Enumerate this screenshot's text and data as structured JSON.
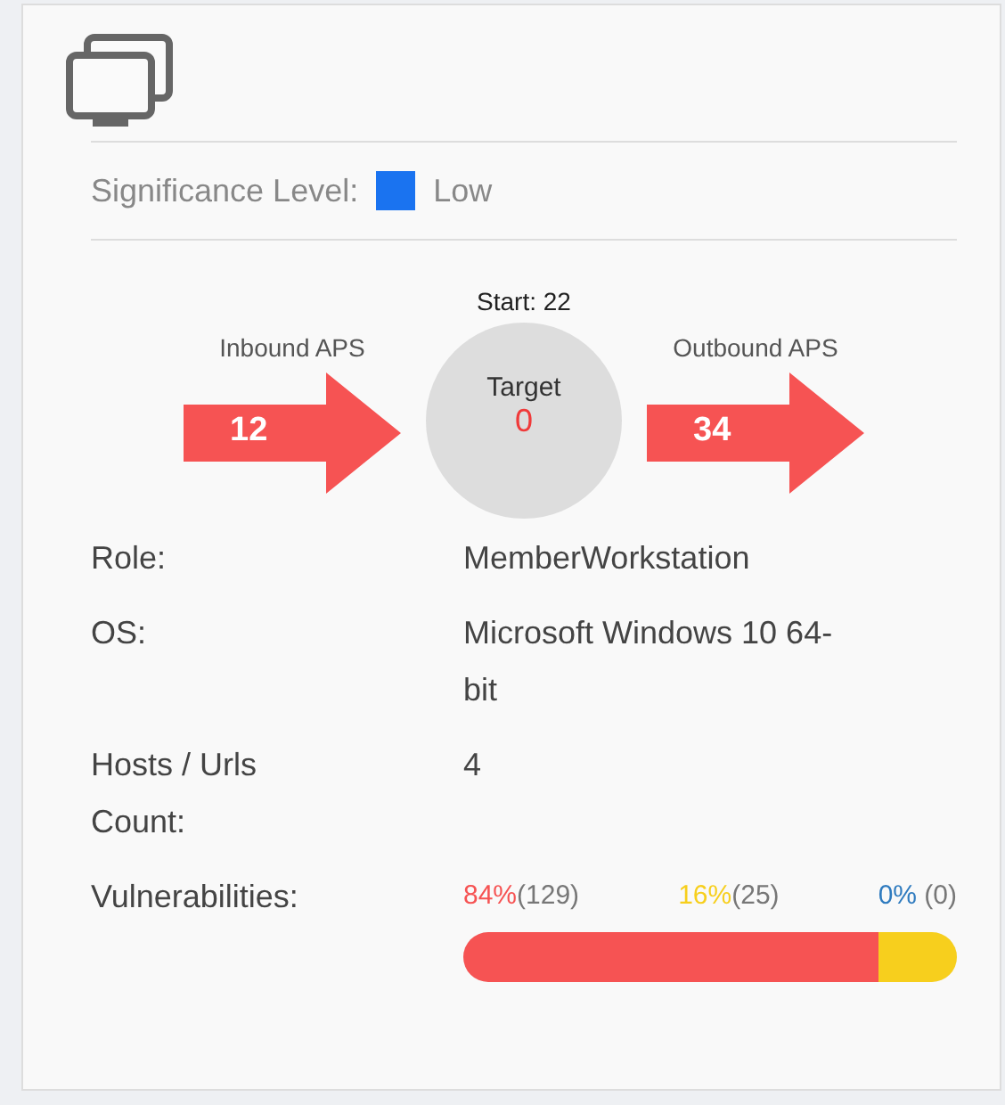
{
  "significance": {
    "label": "Significance Level:",
    "value": "Low",
    "color": "#1a73f0"
  },
  "flow": {
    "start": "Start: 22",
    "inbound": {
      "label": "Inbound APS",
      "count": "12"
    },
    "target": {
      "label": "Target",
      "count": "0"
    },
    "outbound": {
      "label": "Outbound APS",
      "count": "34"
    }
  },
  "details": [
    {
      "label": "Role:",
      "value": "MemberWorkstation"
    },
    {
      "label": "OS:",
      "value": "Microsoft Windows 10 64-bit"
    },
    {
      "label": "Hosts / Urls Count:",
      "value": "4"
    }
  ],
  "vulnerabilities": {
    "label": "Vulnerabilities:",
    "stats": [
      {
        "percent": "84%",
        "count": "(129)",
        "color": "#f65353"
      },
      {
        "percent": "16%",
        "count": "(25)",
        "color": "#f7cf1d"
      },
      {
        "percent": "0%",
        "count": " (0)",
        "color": "#2f7bbf"
      }
    ],
    "bar": [
      {
        "color": "#f65353",
        "level": 0.84
      },
      {
        "color": "#f7cf1d",
        "level": 0.16
      }
    ]
  }
}
